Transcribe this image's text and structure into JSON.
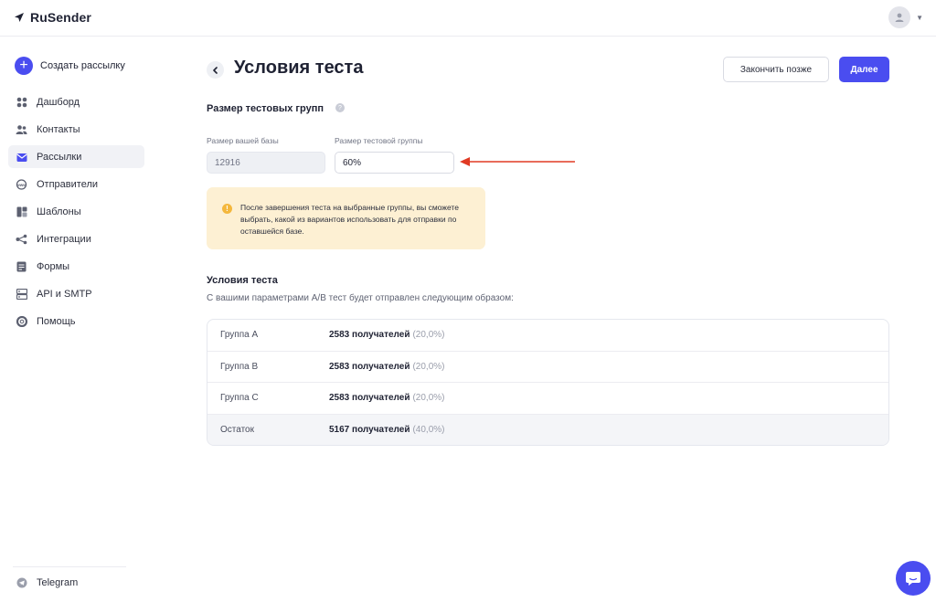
{
  "app": {
    "name": "RuSender",
    "colors": {
      "accent": "#4a4df0",
      "notice_bg": "#fdf0d3",
      "notice_icon": "#f4b73c",
      "arrow": "#e03a24"
    }
  },
  "sidebar": {
    "create_label": "Создать рассылку",
    "items": [
      {
        "label": "Дашборд",
        "icon": "dashboard-icon"
      },
      {
        "label": "Контакты",
        "icon": "contacts-icon"
      },
      {
        "label": "Рассылки",
        "icon": "mailings-icon",
        "active": true
      },
      {
        "label": "Отправители",
        "icon": "senders-icon"
      },
      {
        "label": "Шаблоны",
        "icon": "templates-icon"
      },
      {
        "label": "Интеграции",
        "icon": "integrations-icon"
      },
      {
        "label": "Формы",
        "icon": "forms-icon"
      },
      {
        "label": "API и SMTP",
        "icon": "api-icon"
      },
      {
        "label": "Помощь",
        "icon": "help-icon"
      }
    ],
    "telegram_label": "Telegram"
  },
  "header": {
    "title": "Условия теста",
    "later_label": "Закончить позже",
    "next_label": "Далее"
  },
  "groups_section": {
    "title": "Размер тестовых групп",
    "base_label": "Размер вашей базы",
    "base_value": "12916",
    "test_label": "Размер тестовой группы",
    "test_value": "60%"
  },
  "notice": {
    "text": "После завершения теста на выбранные группы, вы сможете выбрать, какой из вариантов использовать для отправки по оставшейся базе."
  },
  "conditions": {
    "title": "Условия теста",
    "subtitle": "С вашими параметрами A/B тест будет отправлен следующим образом:",
    "rows": [
      {
        "group": "Группа A",
        "count": "2583 получателей",
        "pct": "(20,0%)"
      },
      {
        "group": "Группа B",
        "count": "2583 получателей",
        "pct": "(20,0%)"
      },
      {
        "group": "Группа C",
        "count": "2583 получателей",
        "pct": "(20,0%)"
      },
      {
        "group": "Остаток",
        "count": "5167 получателей",
        "pct": "(40,0%)"
      }
    ]
  }
}
